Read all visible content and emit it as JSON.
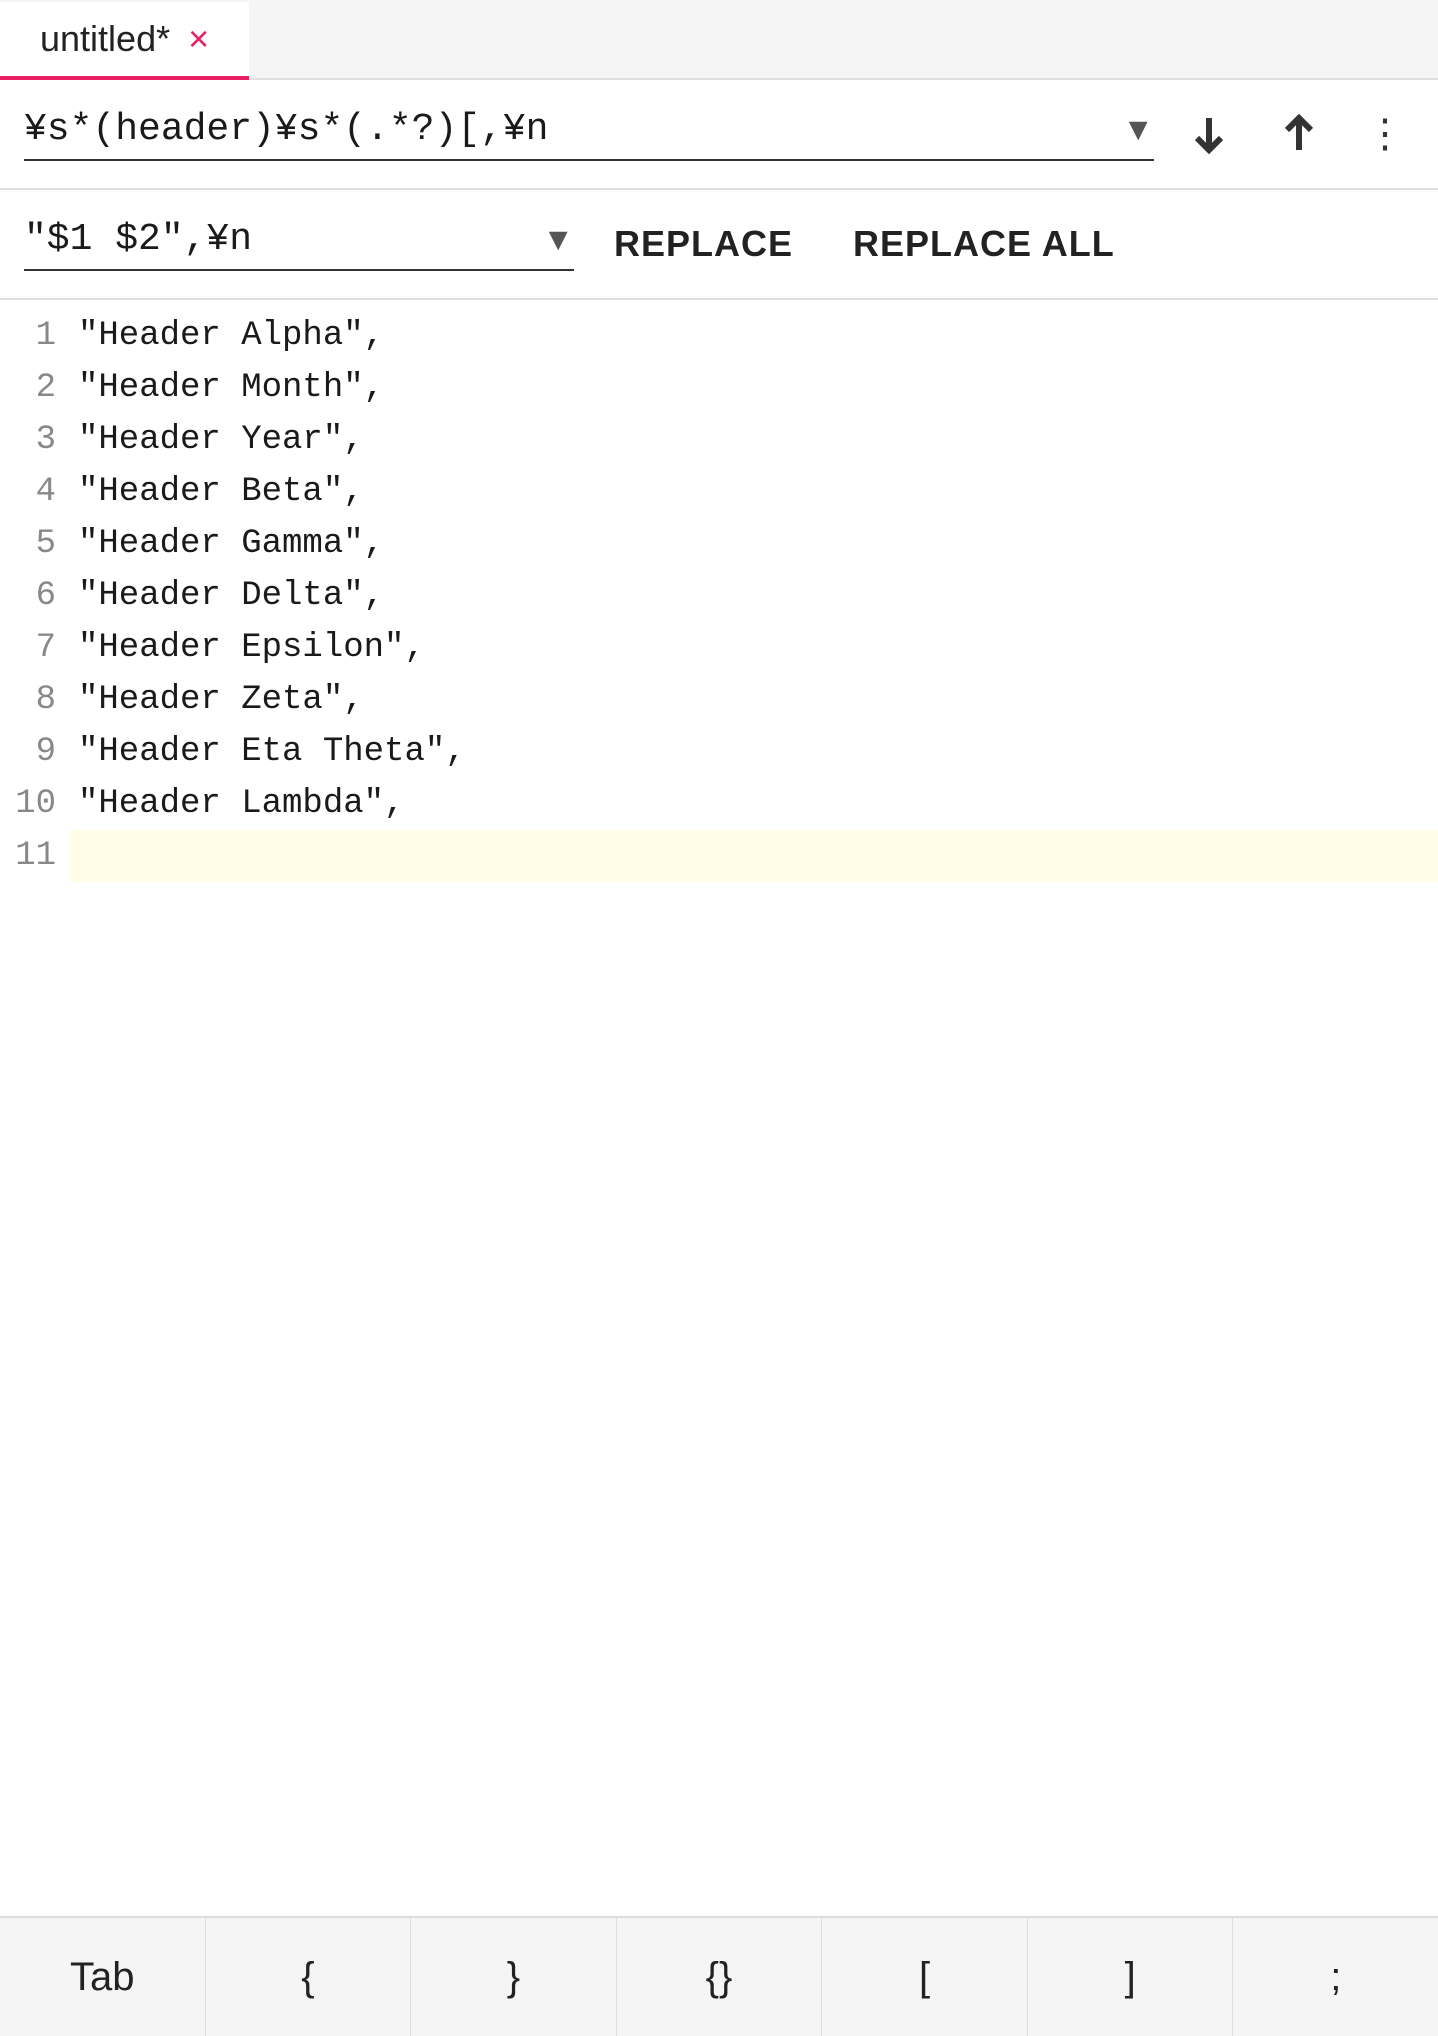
{
  "tab": {
    "label": "untitled*",
    "close_icon": "×",
    "active": true
  },
  "search": {
    "query": "¥s*(header)¥s*(.*?)[,¥n",
    "dropdown_arrow": "▼",
    "down_icon": "↓",
    "up_icon": "↑",
    "more_icon": "⋮"
  },
  "replace": {
    "value": "\"$1 $2\",¥n",
    "dropdown_arrow": "▼",
    "replace_label": "REPLACE",
    "replace_all_label": "REPLACE ALL"
  },
  "editor": {
    "lines": [
      {
        "number": "1",
        "code": "\"Header Alpha\",",
        "highlighted": false
      },
      {
        "number": "2",
        "code": "\"Header Month\",",
        "highlighted": false
      },
      {
        "number": "3",
        "code": "\"Header Year\",",
        "highlighted": false
      },
      {
        "number": "4",
        "code": "\"Header Beta\",",
        "highlighted": false
      },
      {
        "number": "5",
        "code": "\"Header Gamma\",",
        "highlighted": false
      },
      {
        "number": "6",
        "code": "\"Header Delta\",",
        "highlighted": false
      },
      {
        "number": "7",
        "code": "\"Header Epsilon\",",
        "highlighted": false
      },
      {
        "number": "8",
        "code": "\"Header Zeta\",",
        "highlighted": false
      },
      {
        "number": "9",
        "code": "\"Header Eta Theta\",",
        "highlighted": false
      },
      {
        "number": "10",
        "code": "\"Header Lambda\",",
        "highlighted": false
      },
      {
        "number": "11",
        "code": "",
        "highlighted": true
      }
    ]
  },
  "keyboard": {
    "keys": [
      "Tab",
      "{",
      "}",
      "{}",
      "[",
      "]",
      ";"
    ]
  }
}
